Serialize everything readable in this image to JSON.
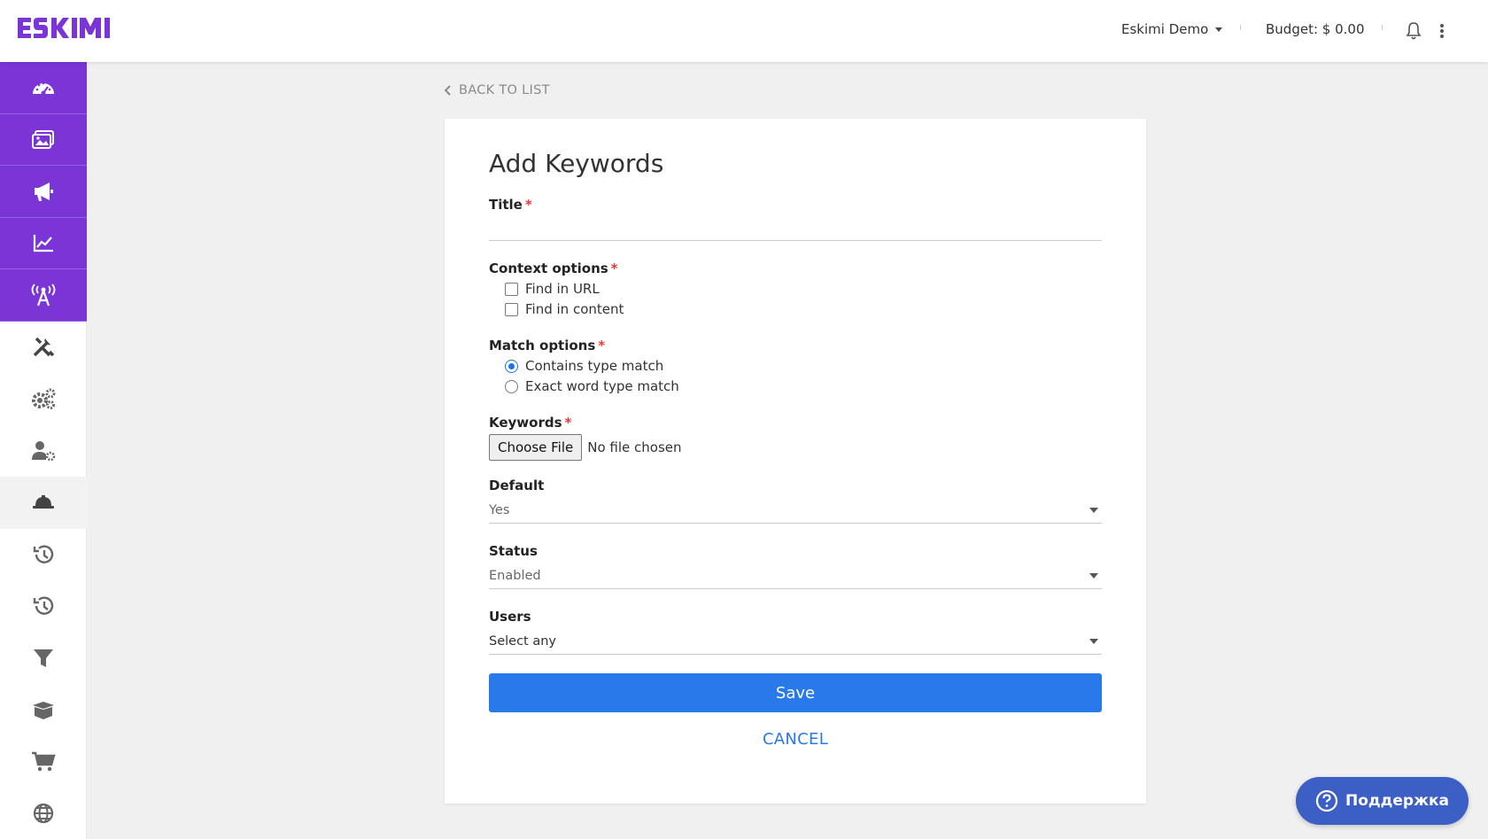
{
  "header": {
    "logo_text": "ESKIMI",
    "account": "Eskimi Demo",
    "budget": "Budget: $ 0.00"
  },
  "sidebar": {
    "items": [
      {
        "icon": "dashboard-icon",
        "group": "purple"
      },
      {
        "icon": "creatives-icon",
        "group": "purple"
      },
      {
        "icon": "megaphone-icon",
        "group": "purple"
      },
      {
        "icon": "chart-icon",
        "group": "purple"
      },
      {
        "icon": "broadcast-icon",
        "group": "purple"
      },
      {
        "icon": "tools-icon",
        "group": "white"
      },
      {
        "icon": "gears-icon",
        "group": "white"
      },
      {
        "icon": "user-settings-icon",
        "group": "white"
      },
      {
        "icon": "hard-hat-icon",
        "group": "white",
        "active": true
      },
      {
        "icon": "history-icon",
        "group": "white"
      },
      {
        "icon": "history-icon",
        "group": "white"
      },
      {
        "icon": "filter-icon",
        "group": "white"
      },
      {
        "icon": "box-icon",
        "group": "white"
      },
      {
        "icon": "cart-icon",
        "group": "white"
      },
      {
        "icon": "globe-icon",
        "group": "white"
      }
    ],
    "colors": {
      "purple": "#7b35d6",
      "icon_white_bg": "#555555"
    }
  },
  "back_link": "BACK TO LIST",
  "form": {
    "title": "Add Keywords",
    "title_field": {
      "label": "Title",
      "required": "*",
      "value": ""
    },
    "context": {
      "label": "Context options",
      "required": "*",
      "options": [
        {
          "label": "Find in URL",
          "checked": false
        },
        {
          "label": "Find in content",
          "checked": false
        }
      ]
    },
    "match": {
      "label": "Match options",
      "required": "*",
      "options": [
        {
          "label": "Contains type match",
          "checked": true
        },
        {
          "label": "Exact word type match",
          "checked": false
        }
      ]
    },
    "keywords": {
      "label": "Keywords",
      "required": "*",
      "button": "Choose File",
      "status": "No file chosen"
    },
    "default": {
      "label": "Default",
      "value": "Yes"
    },
    "status": {
      "label": "Status",
      "value": "Enabled"
    },
    "users": {
      "label": "Users",
      "value": "Select any"
    },
    "save": "Save",
    "cancel": "CANCEL"
  },
  "support": {
    "label": "Поддержка",
    "color": "#3b5fc4"
  },
  "colors": {
    "primary": "#2979ea",
    "required": "#e53935"
  }
}
